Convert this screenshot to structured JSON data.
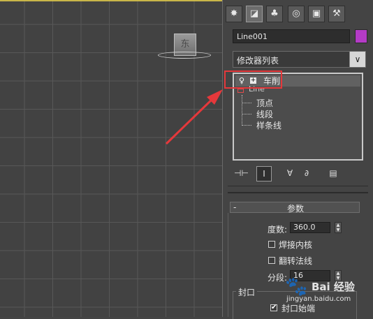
{
  "viewport": {
    "viewcube_label": "东"
  },
  "command_panel": {
    "tabs": [
      {
        "name": "create",
        "icon": "✸"
      },
      {
        "name": "modify",
        "icon": "◪"
      },
      {
        "name": "hierarchy",
        "icon": "♣"
      },
      {
        "name": "motion",
        "icon": "◎"
      },
      {
        "name": "display",
        "icon": "▣"
      },
      {
        "name": "utilities",
        "icon": "⚒"
      }
    ],
    "object_name": "Line001",
    "object_color": "#b43bc6",
    "modifier_list": "修改器列表",
    "dropdown_arrow": "∨",
    "stack": {
      "lathe_label": "车削",
      "lathe_bulb": "♀",
      "lathe_plus": "+",
      "line_label": "Line",
      "subitems": [
        "顶点",
        "线段",
        "样条线"
      ]
    },
    "toolbar_icons": [
      "⊣⊢",
      "Ⅰ",
      "∀",
      "∂",
      "▤"
    ]
  },
  "parameters": {
    "title": "参数",
    "collapse": "-",
    "degrees_label": "度数:",
    "degrees_value": "360.0",
    "weld_core": "焊接内核",
    "flip_normals": "翻转法线",
    "segments_label": "分段:",
    "segments_value": "16",
    "spinner_up": "▲",
    "spinner_down": "▼"
  },
  "capping": {
    "title": "封口",
    "cap_start": "封口始端",
    "cap_start_checked": "✔"
  },
  "watermark": {
    "paw": "🐾",
    "text": "Bai 经验",
    "url": "jingyan.baidu.com"
  }
}
